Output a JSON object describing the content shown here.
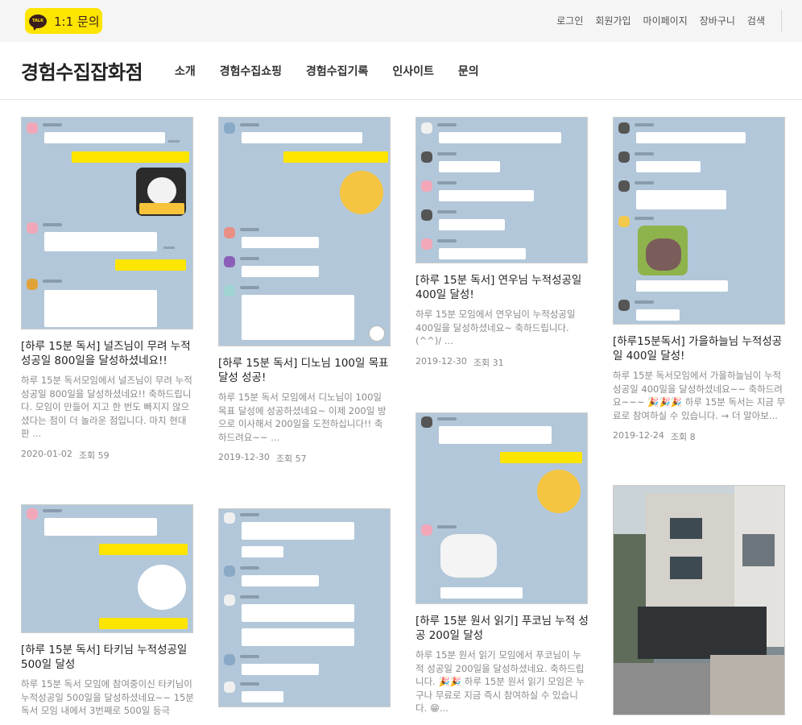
{
  "topbar": {
    "kakao_icon": "talk-bubble-icon",
    "kakao_icon_text": "TALK",
    "kakao_label": "1:1 문의",
    "links": [
      "로그인",
      "회원가입",
      "마이페이지",
      "장바구니",
      "검색"
    ]
  },
  "header": {
    "title": "경험수집잡화점",
    "nav": [
      "소개",
      "경험수집쇼핑",
      "경험수집기록",
      "인사이트",
      "문의"
    ]
  },
  "colors": {
    "kakao_yellow": "#fee500",
    "chat_bg": "#b2c7d9"
  },
  "posts": [
    {
      "title": "[하루 15분 독서] 널즈님이 무려 누적성공일 800일을 달성하셨네요!!",
      "desc": "하루 15분 독서모임에서 널즈님이 무려 누적성공일 800일을 달성하셨네요!! 축하드립니다. 모임이 만들어 지고 한 번도 빠지지 않으셨다는 점이 더 놀라운 점입니다. 마치 현대판 ...",
      "date": "2020-01-02",
      "views": "조회 59"
    },
    {
      "title": "[하루 15분 독서] 디노님 100일 목표달성 성공!",
      "desc": "하루 15분 독서 모임에서 디노님이 100일 목표 달성에 성공하셨네요~ 이제 200일 방으로 이사해서 200일을 도전하십니다!! 축하드려요~~ ...",
      "date": "2019-12-30",
      "views": "조회 57"
    },
    {
      "title": "[하루 15분 독서] 연우님 누적성공일 400일 달성!",
      "desc": "하루 15분 모임에서 연우님이 누적성공일 400일을 달성하셨네요~ 축하드립니다. (^^)/ ...",
      "date": "2019-12-30",
      "views": "조회 31"
    },
    {
      "title": "[하루15분독서] 가을하늘님 누적성공일 400일 달성!",
      "desc": "하루 15분 독서모임에서 가을하늘님이 누적성공일 400일을 달성하셨네요~~ 축하드려요~~~ 🎉🎉🎉 하루 15분 독서는 지금 무료로 참여하실 수 있습니다. → 더 알아보...",
      "date": "2019-12-24",
      "views": "조회 8"
    },
    {
      "title": "[하루 15분 독서] 타키님 누적성공일 500일 달성",
      "desc": "하루 15분 독서 모임에 참여중이신 타키님이 누적성공일 500일을 달성하셨네요~~ 15분 독서 모임 내에서 3번째로 500일 등극",
      "date": "",
      "views": ""
    },
    {
      "title": "[하루 15분 원서 읽기] 푸코님 누적 성공 200일 달성",
      "desc": "하루 15분 원서 읽기 모임에서 푸코님이 누적 성공일 200일을 달성하셨네요. 축하드립니다. 🎉🎉 하루 15분 원서 읽기 모임은 누구나 무료로 지금 즉시 참여하실 수 있습니다. 😁...",
      "date": "",
      "views": ""
    }
  ]
}
